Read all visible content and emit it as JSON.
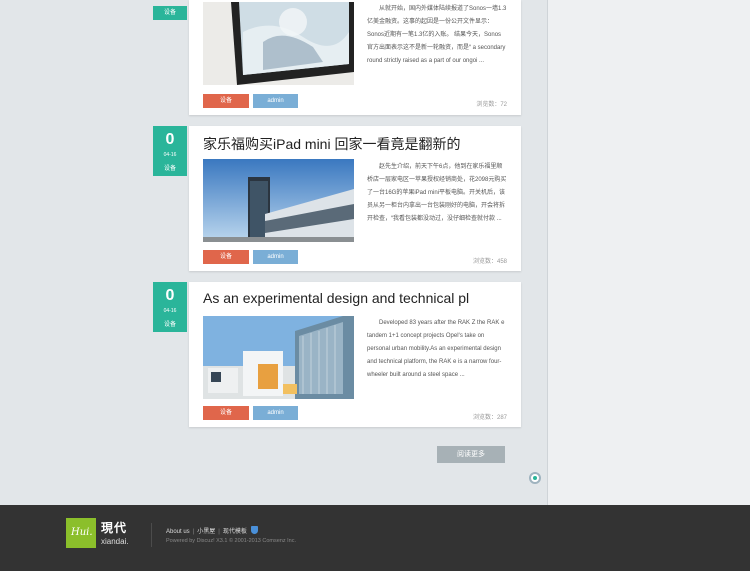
{
  "posts": [
    {
      "category": "设备",
      "title": "",
      "excerpt": "从就开始，国内外媒体陆续报道了Sonos一墙1.3亿美金融资。这事的起因是一份公开文件显示：Sonos近期有一笔1.3亿的入账。 结果今天，Sonos官方出面表示这不是新一轮融资，而是“ a secondary round strictly raised as a part of our ongoi ...",
      "cat_button": "设备",
      "author": "admin",
      "views": "浏览数：72"
    },
    {
      "date_num": "0",
      "date_small": "04-16",
      "category": "设备",
      "title": "家乐福购买iPad mini 回家一看竟是翻新的",
      "excerpt": "赵先生介绍，前天下午6点，他到在家乐福里顺桥店一层家电区一苹果授权经销商处，花2098元购买了一台16G的苹果iPad mini平板电脑。开关机后，该员从另一柜台内拿出一台包装刚好的电脑，开会将拆开检查，“我看包装都没动过，没仔细检查就付款 ...",
      "cat_button": "设备",
      "author": "admin",
      "views": "浏览数：458"
    },
    {
      "date_num": "0",
      "date_small": "04-16",
      "category": "设备",
      "title": "As an experimental design and technical pl",
      "excerpt": "Developed 83 years after the RAK Z the RAK e tandem 1+1 concept projects Opel‘s take on personal urban mobility.As an experimental design and technical platform, the RAK e is a narrow four-wheeler built around a steel space ...",
      "cat_button": "设备",
      "author": "admin",
      "views": "浏览数：287"
    }
  ],
  "load_more": "阅读更多",
  "footer": {
    "logo_text": "Hui.",
    "logo_cn": "現代",
    "logo_en": "xiandai.",
    "links": [
      "About us",
      "小黑屋",
      "现代模板"
    ],
    "powered": "Powered by Discuz! X3.1 © 2001-2013 Comsenz Inc."
  }
}
